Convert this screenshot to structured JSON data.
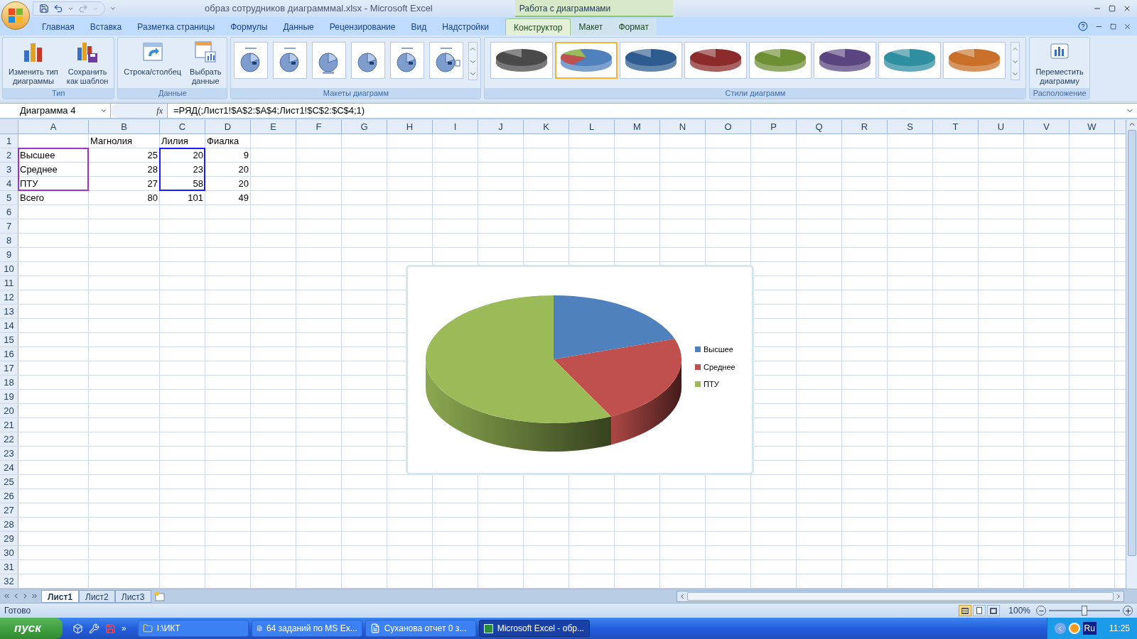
{
  "window": {
    "title": "образ сотрудников диаграмммal.xlsx - Microsoft Excel",
    "context_header": "Работа с диаграммами"
  },
  "tabs": [
    {
      "label": "Главная",
      "selected": false,
      "context": false
    },
    {
      "label": "Вставка",
      "selected": false,
      "context": false
    },
    {
      "label": "Разметка страницы",
      "selected": false,
      "context": false
    },
    {
      "label": "Формулы",
      "selected": false,
      "context": false
    },
    {
      "label": "Данные",
      "selected": false,
      "context": false
    },
    {
      "label": "Рецензирование",
      "selected": false,
      "context": false
    },
    {
      "label": "Вид",
      "selected": false,
      "context": false
    },
    {
      "label": "Надстройки",
      "selected": false,
      "context": false
    },
    {
      "label": "Конструктор",
      "selected": true,
      "context": true
    },
    {
      "label": "Макет",
      "selected": false,
      "context": true
    },
    {
      "label": "Формат",
      "selected": false,
      "context": true
    }
  ],
  "ribbon": {
    "groups": [
      {
        "kind": "buttons",
        "label": "Тип",
        "buttons": [
          {
            "kind": "bars",
            "label": "Изменить тип\nдиаграммы"
          },
          {
            "kind": "template",
            "label": "Сохранить\nкак шаблон"
          }
        ]
      },
      {
        "kind": "buttons",
        "label": "Данные",
        "buttons": [
          {
            "kind": "switch",
            "label": "Строка/столбец"
          },
          {
            "kind": "data",
            "label": "Выбрать\nданные"
          }
        ]
      },
      {
        "kind": "layouts",
        "label": "Макеты диаграмм",
        "count_items": [
          {
            "kind": "legend"
          },
          {
            "kind": "title"
          },
          {
            "kind": "plain"
          },
          {
            "kind": "labels"
          },
          {
            "kind": "title"
          },
          {
            "kind": "table"
          }
        ]
      },
      {
        "kind": "styles",
        "label": "Стили диаграмм",
        "styles": [
          {
            "color": "#4a4a4a",
            "kind": "mono",
            "selected": false
          },
          {
            "color": "#4f81bd",
            "kind": "multi",
            "selected": true
          },
          {
            "color": "#2e5c8f",
            "kind": "mono",
            "selected": false
          },
          {
            "color": "#8b2b2b",
            "kind": "mono",
            "selected": false
          },
          {
            "color": "#6f8f35",
            "kind": "mono",
            "selected": false
          },
          {
            "color": "#5b4580",
            "kind": "mono",
            "selected": false
          },
          {
            "color": "#2f8fa0",
            "kind": "mono",
            "selected": false
          },
          {
            "color": "#c8702a",
            "kind": "mono",
            "selected": false
          }
        ]
      },
      {
        "kind": "buttons",
        "label": "Расположение",
        "buttons": [
          {
            "kind": "move",
            "label": "Переместить\nдиаграмму"
          }
        ]
      }
    ]
  },
  "formula_bar": {
    "name_box": "Диаграмма 4",
    "fx": "fx",
    "formula": "=РЯД(;Лист1!$A$2:$A$4;Лист1!$C$2:$C$4;1)"
  },
  "sheet": {
    "columns": [
      {
        "label": "A",
        "color": "#9933cc"
      },
      {
        "label": "B"
      },
      {
        "label": "C",
        "color": "#1a1aff"
      },
      {
        "label": "D"
      },
      {
        "label": "E"
      },
      {
        "label": "F"
      },
      {
        "label": "G"
      },
      {
        "label": "H"
      },
      {
        "label": "I"
      },
      {
        "label": "J"
      },
      {
        "label": "K"
      },
      {
        "label": "L"
      },
      {
        "label": "M"
      },
      {
        "label": "N"
      },
      {
        "label": "O"
      },
      {
        "label": "P"
      },
      {
        "label": "Q"
      },
      {
        "label": "R"
      },
      {
        "label": "S"
      },
      {
        "label": "T"
      },
      {
        "label": "U"
      },
      {
        "label": "V"
      },
      {
        "label": "W"
      }
    ],
    "rows": [
      {
        "header": "1",
        "kind": "headings",
        "in_range": false,
        "cells": [
          "Магнолия",
          "Лилия",
          "Фиалка"
        ]
      },
      {
        "header": "2",
        "kind": "data",
        "in_range": true,
        "label": "Высшее",
        "values": [
          "25",
          "20",
          "9"
        ]
      },
      {
        "header": "3",
        "kind": "data",
        "in_range": true,
        "label": "Среднее",
        "values": [
          "28",
          "23",
          "20"
        ]
      },
      {
        "header": "4",
        "kind": "data",
        "in_range": true,
        "label": "ПТУ",
        "values": [
          "27",
          "58",
          "20"
        ]
      },
      {
        "header": "5",
        "kind": "data",
        "in_range": false,
        "label": "Всего",
        "values": [
          "80",
          "101",
          "49"
        ]
      },
      {
        "header": "6",
        "kind": "empty",
        "in_range": false
      },
      {
        "header": "7",
        "kind": "empty",
        "in_range": false
      },
      {
        "header": "8",
        "kind": "empty",
        "in_range": false
      },
      {
        "header": "9",
        "kind": "empty",
        "in_range": false
      },
      {
        "header": "10",
        "kind": "empty",
        "in_range": false
      },
      {
        "header": "11",
        "kind": "empty",
        "in_range": false
      },
      {
        "header": "12",
        "kind": "empty",
        "in_range": false
      },
      {
        "header": "13",
        "kind": "empty",
        "in_range": false
      },
      {
        "header": "14",
        "kind": "empty",
        "in_range": false
      },
      {
        "header": "15",
        "kind": "empty",
        "in_range": false
      },
      {
        "header": "16",
        "kind": "empty",
        "in_range": false
      },
      {
        "header": "17",
        "kind": "empty",
        "in_range": false
      },
      {
        "header": "18",
        "kind": "empty",
        "in_range": false
      },
      {
        "header": "19",
        "kind": "empty",
        "in_range": false
      },
      {
        "header": "20",
        "kind": "empty",
        "in_range": false
      },
      {
        "header": "21",
        "kind": "empty",
        "in_range": false
      },
      {
        "header": "22",
        "kind": "empty",
        "in_range": false
      },
      {
        "header": "23",
        "kind": "empty",
        "in_range": false
      },
      {
        "header": "24",
        "kind": "empty",
        "in_range": false
      },
      {
        "header": "25",
        "kind": "empty",
        "in_range": false
      },
      {
        "header": "26",
        "kind": "empty",
        "in_range": false
      },
      {
        "header": "27",
        "kind": "empty",
        "in_range": false
      },
      {
        "header": "28",
        "kind": "empty",
        "in_range": false
      },
      {
        "header": "29",
        "kind": "empty",
        "in_range": false
      },
      {
        "header": "30",
        "kind": "empty",
        "in_range": false
      },
      {
        "header": "31",
        "kind": "empty",
        "in_range": false
      },
      {
        "header": "32",
        "kind": "empty",
        "in_range": false
      }
    ]
  },
  "chart": {
    "legend": [
      {
        "label": "Высшее",
        "color": "#4f81bd"
      },
      {
        "label": "Среднее",
        "color": "#c0504d"
      },
      {
        "label": "ПТУ",
        "color": "#9bbb59"
      }
    ]
  },
  "sheet_tabs": [
    {
      "label": "Лист1",
      "selected": true
    },
    {
      "label": "Лист2",
      "selected": false
    },
    {
      "label": "Лист3",
      "selected": false
    }
  ],
  "status_bar": {
    "status": "Готово",
    "views": [
      {
        "kind": "normal",
        "selected": true
      },
      {
        "kind": "layout",
        "selected": false
      },
      {
        "kind": "pagebreak",
        "selected": false
      }
    ],
    "zoom": "100%",
    "zoom_level": {
      "level": 0.5
    }
  },
  "taskbar": {
    "start": "пуск",
    "more": "»",
    "tasks": [
      {
        "kind": "folder",
        "label": "I:\\ИКТ",
        "selected": false
      },
      {
        "kind": "word",
        "label": "64 заданий по MS Ex...",
        "selected": false
      },
      {
        "kind": "word",
        "label": "Суханова отчет 0 з...",
        "selected": false
      },
      {
        "kind": "excel",
        "label": "Microsoft Excel - обр...",
        "selected": true
      }
    ],
    "language": "Ru",
    "time": "11:25"
  }
}
